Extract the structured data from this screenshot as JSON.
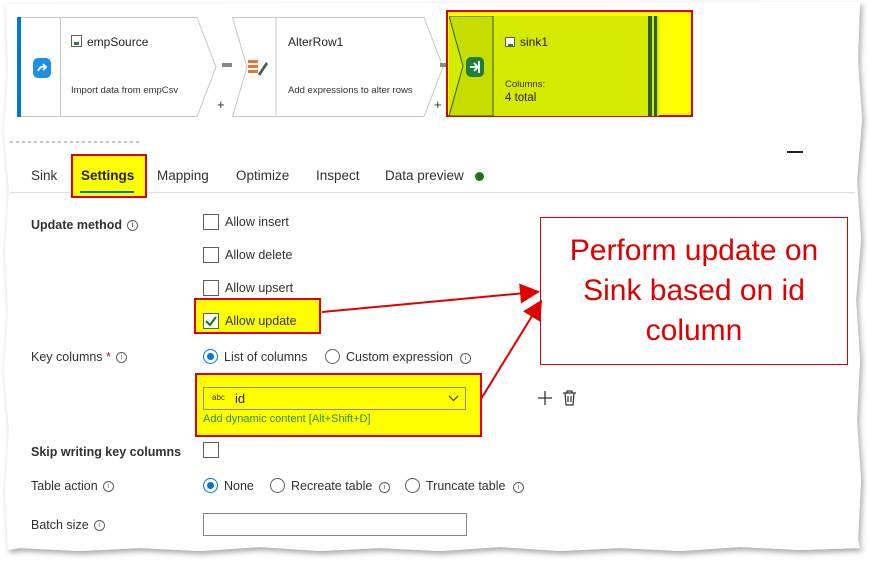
{
  "pipeline": {
    "source": {
      "title": "empSource",
      "description": "Import data from empCsv"
    },
    "alter": {
      "title": "AlterRow1",
      "description": "Add expressions to alter rows"
    },
    "sink": {
      "title": "sink1",
      "columns_label": "Columns:",
      "columns_value": "4 total"
    },
    "add_symbol": "+"
  },
  "tabs": [
    "Sink",
    "Settings",
    "Mapping",
    "Optimize",
    "Inspect",
    "Data preview"
  ],
  "settings": {
    "update_method": {
      "label": "Update method",
      "options": [
        {
          "label": "Allow insert",
          "checked": false
        },
        {
          "label": "Allow delete",
          "checked": false
        },
        {
          "label": "Allow upsert",
          "checked": false
        },
        {
          "label": "Allow update",
          "checked": true
        }
      ]
    },
    "key_columns": {
      "label": "Key columns",
      "required_mark": "*",
      "options": [
        "List of columns",
        "Custom expression"
      ],
      "selected": "List of columns",
      "column_type": "abc",
      "column_value": "id",
      "dynamic_content_link": "Add dynamic content [Alt+Shift+D]"
    },
    "skip_writing": {
      "label": "Skip writing key columns",
      "checked": false
    },
    "table_action": {
      "label": "Table action",
      "options": [
        "None",
        "Recreate table",
        "Truncate table"
      ],
      "selected": "None"
    },
    "batch_size": {
      "label": "Batch size",
      "value": ""
    }
  },
  "annotation": {
    "line1": "Perform update on",
    "line2": "Sink based on id",
    "line3": "column"
  },
  "colors": {
    "highlight": "#ffff00",
    "annotation_red": "#e00000",
    "accent_blue": "#0078d4",
    "status_green": "#107c10",
    "link_green": "#2b8a1e"
  }
}
